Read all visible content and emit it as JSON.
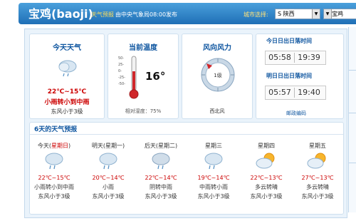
{
  "header": {
    "city": "宝鸡(baoji)",
    "forecast_label": "天气预报",
    "source": "由中央气象局08:00发布",
    "city_select_label": "城市选择:",
    "province": "S 陕西",
    "city_option": "B 宝鸡"
  },
  "today": {
    "title": "今天天气",
    "icon": "light-rain-cloud-icon",
    "temp": "22℃~15℃",
    "desc": "小雨转小到中雨",
    "wind": "东风小于3级"
  },
  "current": {
    "title": "当前温度",
    "temp": "16°",
    "thermometer_scale": [
      "50-",
      "25-",
      "0-",
      "-25-",
      "-50-"
    ],
    "humidity": "相对湿度：75%"
  },
  "wind": {
    "title": "风向风力",
    "level": "1级",
    "direction": "西北风"
  },
  "sun": {
    "today_title": "今日日出日落时间",
    "today_rise": "05:58",
    "today_set": "19:39",
    "tomorrow_title": "明日日出日落时间",
    "tomorrow_rise": "05:57",
    "tomorrow_set": "19:40",
    "postcode": "邮政编码"
  },
  "forecast": {
    "title": "6天的天气预报",
    "days": [
      {
        "name": "今天(",
        "name_highlight": "星期日",
        "name_end": ")",
        "icon": "rain-cloud-icon",
        "temp": "22℃~15℃",
        "desc": "小雨转小到中雨",
        "wind": "东风小于3级"
      },
      {
        "name": "明天(星期一)",
        "icon": "rain-cloud-icon",
        "temp": "20℃~14℃",
        "desc": "小雨",
        "wind": "东风小于3级"
      },
      {
        "name": "后天(星期二)",
        "icon": "cloud-rain-icon",
        "temp": "22℃~14℃",
        "desc": "阴转中雨",
        "wind": "东风小于3级"
      },
      {
        "name": "星期三",
        "icon": "rain-cloud-icon",
        "temp": "19℃~14℃",
        "desc": "中雨转小雨",
        "wind": "东风小于3级"
      },
      {
        "name": "星期四",
        "icon": "sun-cloud-icon",
        "temp": "22℃~13℃",
        "desc": "多云转晴",
        "wind": "东风小于3级"
      },
      {
        "name": "星期五",
        "icon": "sun-cloud-icon",
        "temp": "27℃~13℃",
        "desc": "多云转晴",
        "wind": "东风小于3级"
      }
    ]
  },
  "colors": {
    "header": "#2a7ec4",
    "accent_red": "#cc0000",
    "title_blue": "#0f56a0"
  }
}
